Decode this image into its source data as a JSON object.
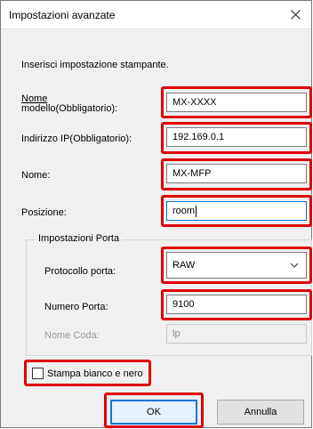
{
  "window": {
    "title": "Impostazioni avanzate"
  },
  "intro": "Inserisci impostazione stampante.",
  "fields": {
    "model_name": {
      "label_line1": "Nome",
      "label_line2": "modello(Obbligatorio):",
      "value": "MX-XXXX"
    },
    "ip_address": {
      "label": "Indirizzo IP(Obbligatorio):",
      "value": "192.169.0.1"
    },
    "name": {
      "label": "Nome:",
      "value": "MX-MFP"
    },
    "position": {
      "label": "Posizione:",
      "value": "room"
    }
  },
  "port_settings": {
    "title": "Impostazioni Porta",
    "protocol": {
      "label": "Protocollo porta:",
      "value": "RAW"
    },
    "port_number": {
      "label": "Numero Porta:",
      "value": "9100"
    },
    "queue_name": {
      "label": "Nome Coda:",
      "value": "lp"
    }
  },
  "mono_print": {
    "label": "Stampa bianco e nero",
    "checked": false
  },
  "buttons": {
    "ok": "OK",
    "cancel": "Annulla"
  },
  "highlight_color": "#e00000",
  "accent_color": "#0078d7"
}
